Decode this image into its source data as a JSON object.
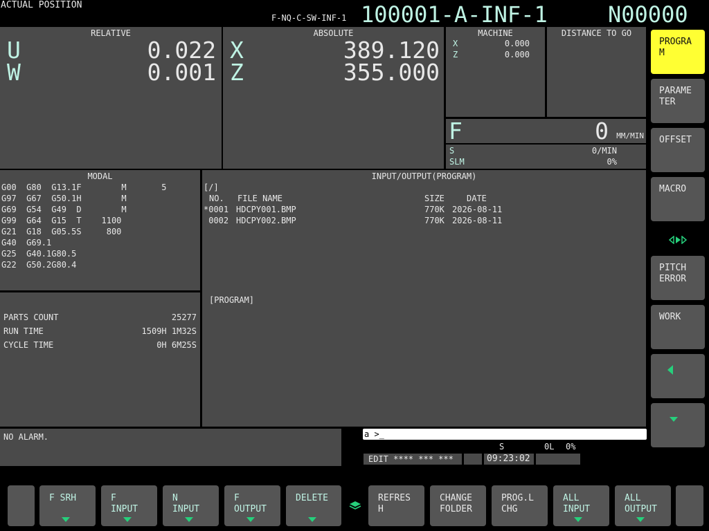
{
  "header": {
    "title": "ACTUAL POSITION",
    "program_file": "F-NQ-C-SW-INF-1",
    "program_id": "100001-A-INF-1",
    "sequence": "N00000"
  },
  "relative": {
    "title": "RELATIVE",
    "axes": [
      {
        "label": "U",
        "value": "0.022"
      },
      {
        "label": "W",
        "value": "0.001"
      }
    ]
  },
  "absolute": {
    "title": "ABSOLUTE",
    "axes": [
      {
        "label": "X",
        "value": "389.120"
      },
      {
        "label": "Z",
        "value": "355.000"
      }
    ]
  },
  "machine": {
    "title": "MACHINE",
    "axes": [
      {
        "label": "X",
        "value": "0.000"
      },
      {
        "label": "Z",
        "value": "0.000"
      }
    ]
  },
  "distance": {
    "title": "DISTANCE TO GO"
  },
  "feed": {
    "label": "F",
    "value": "0",
    "unit": "MM/MIN",
    "s_label": "S",
    "s_value": "0/MIN",
    "slm_label": "SLM",
    "slm_value": "0%"
  },
  "modal": {
    "title": "MODAL",
    "rows": [
      "G00  G80  G13.1F        M       5",
      "G97  G67  G50.1H        M",
      "G69  G54  G49  D        M",
      "G99  G64  G15  T    1100",
      "G21  G18  G05.5S     800",
      "G40  G69.1",
      "G25  G40.1G80.5",
      "G22  G50.2G80.4"
    ]
  },
  "counts": {
    "parts_label": "PARTS COUNT",
    "parts_value": "25277",
    "run_label": "RUN TIME",
    "run_value": "1509H 1M32S",
    "cycle_label": "CYCLE TIME",
    "cycle_value": "0H 6M25S"
  },
  "io": {
    "title": "INPUT/OUTPUT(PROGRAM)",
    "path": "[/]",
    "col_no": "NO.",
    "col_name": "FILE NAME",
    "col_size": "SIZE",
    "col_date": "DATE",
    "files": [
      {
        "no": "*0001",
        "name": "HDCPY001.BMP",
        "size": "770K",
        "date": "2026-08-11"
      },
      {
        "no": " 0002",
        "name": "HDCPY002.BMP",
        "size": "770K",
        "date": "2026-08-11"
      }
    ],
    "device": "[PROGRAM]"
  },
  "alarm": "NO ALARM.",
  "input_line": "a >_",
  "status": {
    "s_label": "S",
    "l_value": "0L",
    "pct": "0%",
    "mode": "EDIT **** *** ***",
    "time": "09:23:02"
  },
  "right_softkeys": [
    "PROGRA\nM",
    "PARAME\nTER",
    "OFFSET",
    "MACRO",
    "PITCH\nERROR",
    "WORK"
  ],
  "bottom_softkeys": [
    {
      "l1": "F SRH",
      "l2": ""
    },
    {
      "l1": "F",
      "l2": "INPUT"
    },
    {
      "l1": "N",
      "l2": "INPUT"
    },
    {
      "l1": "F",
      "l2": "OUTPUT"
    },
    {
      "l1": "DELETE",
      "l2": ""
    },
    {
      "l1": "REFRES",
      "l2": "H"
    },
    {
      "l1": "CHANGE",
      "l2": "FOLDER"
    },
    {
      "l1": "PROG.L",
      "l2": "CHG"
    },
    {
      "l1": "ALL",
      "l2": "INPUT"
    },
    {
      "l1": "ALL",
      "l2": "OUTPUT"
    }
  ],
  "colors": {
    "accent_teal": "#bff3e4",
    "active_key": "#ffff33",
    "arrow_green": "#26d07c",
    "panel": "#4a4a4a"
  }
}
